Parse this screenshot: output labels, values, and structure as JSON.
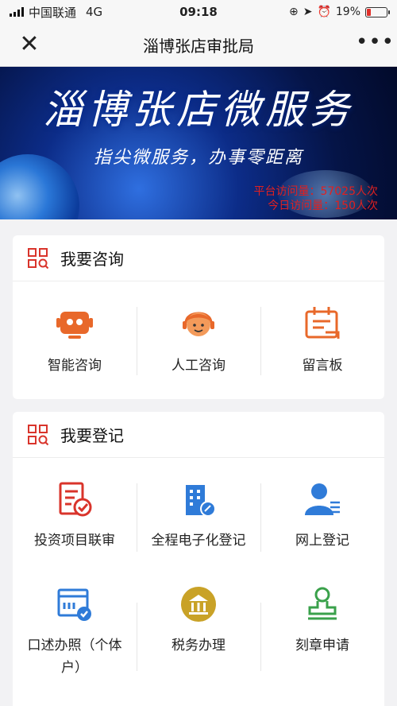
{
  "status_bar": {
    "carrier": "中国联通",
    "network": "4G",
    "time": "09:18",
    "battery": "19%",
    "battery_level": 0.19
  },
  "nav": {
    "title": "淄博张店审批局"
  },
  "banner": {
    "title": "淄博张店微服务",
    "subtitle": "指尖微服务，办事零距离",
    "total_visits": "平台访问量：57025人次",
    "today_visits": "今日访问量：150人次"
  },
  "consult": {
    "title": "我要咨询",
    "items": [
      {
        "label": "智能咨询",
        "icon": "robot-icon"
      },
      {
        "label": "人工咨询",
        "icon": "agent-icon"
      },
      {
        "label": "留言板",
        "icon": "message-board-icon"
      }
    ]
  },
  "register": {
    "title": "我要登记",
    "items": [
      {
        "label": "投资项目联审",
        "icon": "document-check-icon"
      },
      {
        "label": "全程电子化登记",
        "icon": "building-icon"
      },
      {
        "label": "网上登记",
        "icon": "user-list-icon"
      },
      {
        "label": "口述办照（个体户）",
        "icon": "form-check-icon"
      },
      {
        "label": "税务办理",
        "icon": "tax-bank-icon"
      },
      {
        "label": "刻章申请",
        "icon": "seal-stamp-icon"
      }
    ]
  },
  "colors": {
    "accent_orange": "#e8682a",
    "accent_red": "#d9342b",
    "accent_blue": "#2f7bd8",
    "accent_gold": "#c9a227",
    "accent_green": "#3aa14b"
  }
}
